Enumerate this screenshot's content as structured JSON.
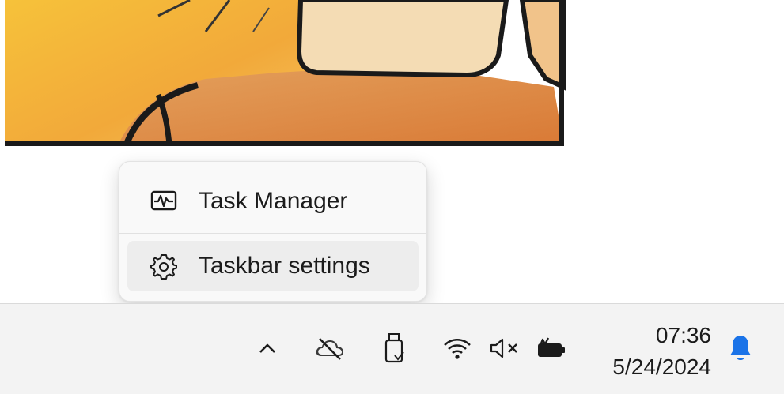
{
  "context_menu": {
    "items": [
      {
        "label": "Task Manager",
        "icon": "task-manager-icon"
      },
      {
        "label": "Taskbar settings",
        "icon": "gear-icon"
      }
    ]
  },
  "taskbar": {
    "tray_icons": [
      "chevron-up-icon",
      "onedrive-cloud-icon",
      "usb-drive-icon",
      "wifi-icon",
      "volume-muted-icon",
      "battery-charging-icon"
    ],
    "clock": {
      "time": "07:36",
      "date": "5/24/2024"
    },
    "notification_icon": "bell-icon"
  },
  "colors": {
    "taskbar_bg": "#f3f3f3",
    "menu_bg": "#f9f9f9",
    "accent": "#1a73e8"
  }
}
